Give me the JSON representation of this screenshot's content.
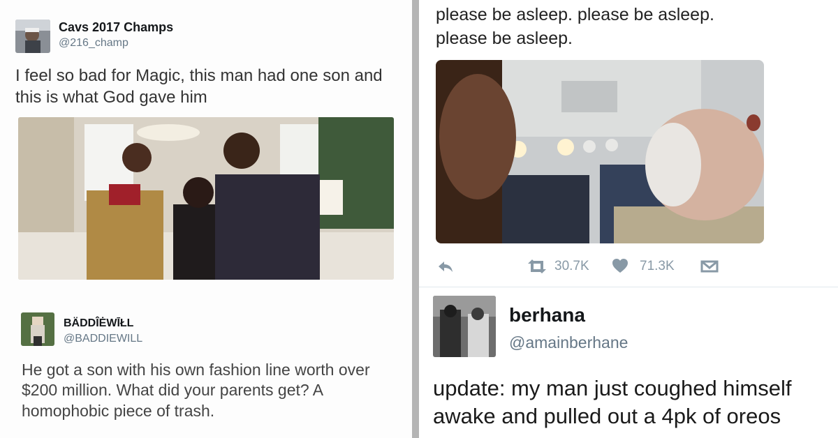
{
  "left": {
    "tweet1": {
      "name": "Cavs 2017 Champs",
      "handle": "@216_champ",
      "text": "I feel so bad for Magic, this man had one son and this is what God gave him",
      "photo_icon": "family-photo"
    },
    "tweet2": {
      "name": "BÄDDÎĖWĪŁL",
      "handle": "@BADDIEWILL",
      "text": "He got a son with his own fashion line worth over $200 million. What did your parents get? A homophobic piece of trash."
    }
  },
  "right": {
    "tweet1": {
      "text": "please be asleep. please be asleep. please be asleep.",
      "photo_icon": "airplane-selfie-photo",
      "retweets": "30.7K",
      "likes": "71.3K"
    },
    "tweet2": {
      "name": "berhana",
      "handle": "@amainberhane",
      "text": "update: my man just coughed himself awake and pulled out a 4pk of oreos"
    }
  },
  "colors": {
    "divider": "#b5b5b5",
    "action": "#8899a6",
    "handle": "#657786"
  }
}
